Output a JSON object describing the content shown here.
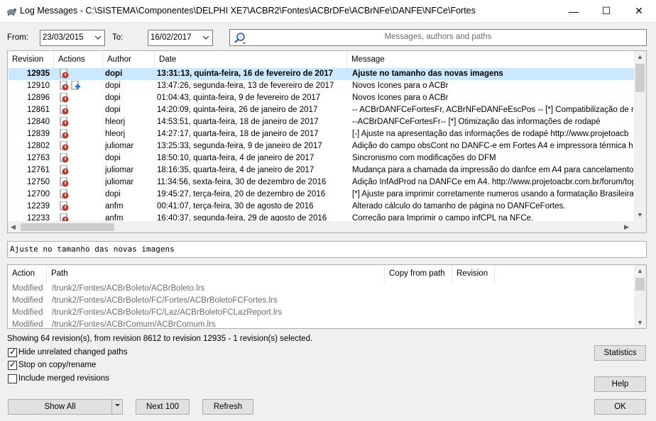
{
  "window": {
    "title": "Log Messages - C:\\SISTEMA\\Componentes\\DELPHI XE7\\ACBR2\\Fontes\\ACBrDFe\\ACBrNFe\\DANFE\\NFCe\\Fortes",
    "minimize": "—",
    "maximize": "☐",
    "close": "✕"
  },
  "filters": {
    "from_label": "From:",
    "from_value": "23/03/2015",
    "to_label": "To:",
    "to_value": "16/02/2017",
    "search_placeholder": "Messages, authors and paths"
  },
  "log_table": {
    "headers": [
      "Revision",
      "Actions",
      "Author",
      "Date",
      "Message"
    ],
    "rows": [
      {
        "revision": "12935",
        "actions": [
          "modified"
        ],
        "author": "dopi",
        "date": "13:31:13, quinta-feira, 16 de fevereiro de 2017",
        "message": "Ajuste no tamanho das novas imagens",
        "selected": true
      },
      {
        "revision": "12910",
        "actions": [
          "modified",
          "added"
        ],
        "author": "dopi",
        "date": "13:47:26, segunda-feira, 13 de fevereiro de 2017",
        "message": "Novos Icones para o ACBr",
        "selected": false
      },
      {
        "revision": "12896",
        "actions": [
          "modified"
        ],
        "author": "dopi",
        "date": "01:04:43, quinta-feira, 9 de fevereiro de 2017",
        "message": "Novos Icones para o ACBr",
        "selected": false
      },
      {
        "revision": "12861",
        "actions": [
          "modified"
        ],
        "author": "dopi",
        "date": "14:20:09, quinta-feira, 26 de janeiro de 2017",
        "message": "-- ACBrDANFCeFortesFr, ACBrNFeDANFeEscPos -- [*] Compatibilização de métodos",
        "selected": false
      },
      {
        "revision": "12840",
        "actions": [
          "modified"
        ],
        "author": "hleorj",
        "date": "14:53:51, quarta-feira, 18 de janeiro de 2017",
        "message": "--ACBrDANFCeFortesFr-- [*] Otimização das informações de rodapé",
        "selected": false
      },
      {
        "revision": "12839",
        "actions": [
          "modified"
        ],
        "author": "hleorj",
        "date": "14:27:17, quarta-feira, 18 de janeiro de 2017",
        "message": "[-] Ajuste na apresentação das informações de rodapé        http://www.projetoacb",
        "selected": false
      },
      {
        "revision": "12802",
        "actions": [
          "modified"
        ],
        "author": "juliomar",
        "date": "13:25:33, segunda-feira, 9 de janeiro de 2017",
        "message": "Adição do campo obsCont no DANFC-e em Fortes A4 e impressora térmica http://ww",
        "selected": false
      },
      {
        "revision": "12763",
        "actions": [
          "modified"
        ],
        "author": "dopi",
        "date": "18:50:10, quarta-feira, 4 de janeiro de 2017",
        "message": "Sincronismo com modificações do DFM",
        "selected": false
      },
      {
        "revision": "12761",
        "actions": [
          "modified"
        ],
        "author": "juliomar",
        "date": "18:16:35, quarta-feira, 4 de janeiro de 2017",
        "message": "Mudança para a chamada da impressão do danfce em A4 para cancelamento http:/",
        "selected": false
      },
      {
        "revision": "12750",
        "actions": [
          "modified"
        ],
        "author": "juliomar",
        "date": "11:34:56, sexta-feira, 30 de dezembro de 2016",
        "message": "Adição InfAdProd na DANFCe em A4. http://www.projetoacbr.com.br/forum/topic/",
        "selected": false
      },
      {
        "revision": "12700",
        "actions": [
          "modified"
        ],
        "author": "dopi",
        "date": "19:45:27, terça-feira, 20 de dezembro de 2016",
        "message": "[*] Ajuste para imprimir corretamente numeros usando a formatação Brasileira     co",
        "selected": false
      },
      {
        "revision": "12239",
        "actions": [
          "modified"
        ],
        "author": "anfm",
        "date": "00:41:07, terça-feira, 30 de agosto de 2016",
        "message": "Alterado cálculo do tamanho de página no DANFCeFortes.",
        "selected": false
      },
      {
        "revision": "12233",
        "actions": [
          "modified"
        ],
        "author": "anfm",
        "date": "16:40:37, segunda-feira, 29 de agosto de 2016",
        "message": "Correção para Imprimir o campo infCPL na NFCe.",
        "selected": false
      }
    ]
  },
  "message_text": "Ajuste no tamanho das novas imagens",
  "paths_table": {
    "headers": [
      "Action",
      "Path",
      "Copy from path",
      "Revision"
    ],
    "rows": [
      {
        "action": "Modified",
        "path": "/trunk2/Fontes/ACBrBoleto/ACBrBoleto.lrs"
      },
      {
        "action": "Modified",
        "path": "/trunk2/Fontes/ACBrBoleto/FC/Fortes/ACBrBoletoFCFortes.lrs"
      },
      {
        "action": "Modified",
        "path": "/trunk2/Fontes/ACBrBoleto/FC/Laz/ACBrBoletoFCLazReport.lrs"
      },
      {
        "action": "Modified",
        "path": "/trunk2/Fontes/ACBrComum/ACBrComum.lrs"
      }
    ]
  },
  "status_text": "Showing 64 revision(s), from revision 8612 to revision 12935 - 1 revision(s) selected.",
  "options": {
    "hide_unrelated": {
      "label": "Hide unrelated changed paths",
      "checked": true
    },
    "stop_on_copy": {
      "label": "Stop on copy/rename",
      "checked": true
    },
    "include_merged": {
      "label": "Include merged revisions",
      "checked": false
    }
  },
  "buttons": {
    "statistics": "Statistics",
    "help": "Help",
    "show_all": "Show All",
    "next_100": "Next 100",
    "refresh": "Refresh",
    "ok": "OK"
  },
  "colors": {
    "selection": "#cce8ff",
    "modified_icon": "#c0392b",
    "added_icon": "#1f6fd1"
  }
}
